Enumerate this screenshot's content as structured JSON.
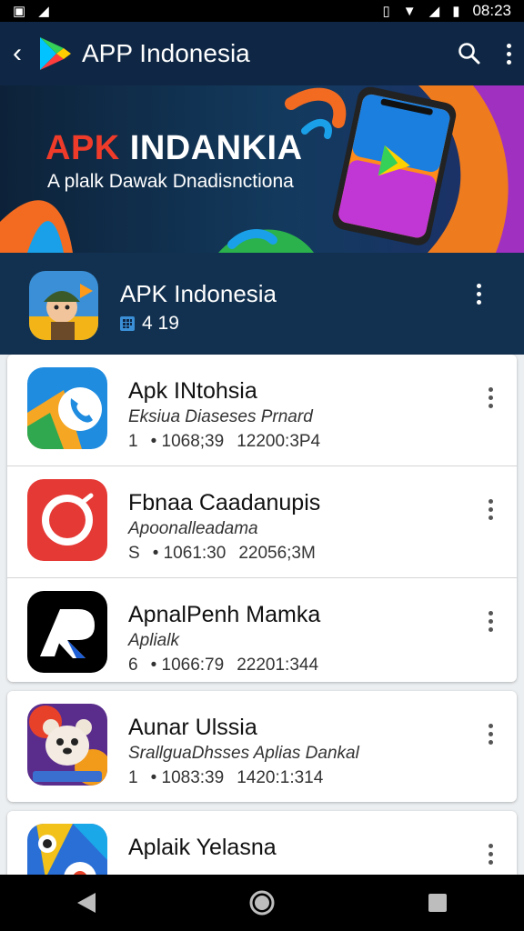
{
  "status": {
    "time": "08:23",
    "left_icons": [
      "photo-icon",
      "signal-n-icon"
    ],
    "right_icons": [
      "vibrate-icon",
      "wifi-icon",
      "cell-icon",
      "battery-icon"
    ]
  },
  "appbar": {
    "title": "APP Indonesia",
    "back_icon": "back-arrow-icon",
    "logo_icon": "play-store-logo-icon",
    "search_icon": "search-icon",
    "more_icon": "overflow-menu-icon"
  },
  "banner": {
    "title_red": "APK",
    "title_white": " INDANKIA",
    "subtitle": "A plalk Dawak Dnadisnctiona"
  },
  "featured": {
    "name": "APK Indonesia",
    "meta": "4 19"
  },
  "apps": [
    {
      "name": "Apk INtohsia",
      "sub": "Eksiua Diaseses Prnard",
      "m1": "1",
      "m2": "• 1068;39",
      "m3": "12200:3P4"
    },
    {
      "name": "Fbnaa Caadanupis",
      "sub": "Apoonalleadama",
      "m1": "S",
      "m2": "• 1061:30",
      "m3": "22056;3M"
    },
    {
      "name": "ApnalPenh Mamka",
      "sub": "Aplialk",
      "m1": "6",
      "m2": "• 1066:79",
      "m3": "22201:344"
    },
    {
      "name": "Aunar Ulssia",
      "sub": "SrallguaDhsses Aplias Dankal",
      "m1": "1",
      "m2": "• 1083:39",
      "m3": "1420:1:314"
    },
    {
      "name": "Aplaik Yelasna",
      "sub": "",
      "m1": "",
      "m2": "",
      "m3": ""
    }
  ],
  "colors": {
    "appbar": "#0f2744",
    "featured": "#123150",
    "accent_red": "#ef3b2a"
  }
}
